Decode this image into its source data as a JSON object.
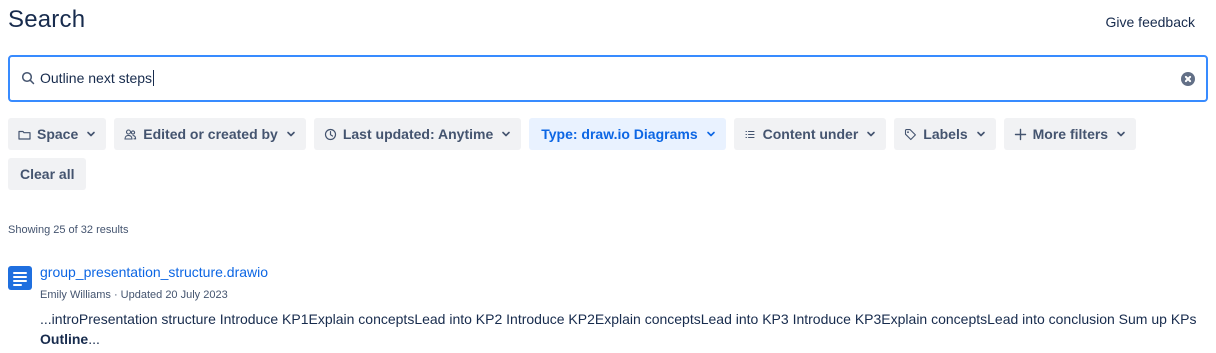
{
  "header": {
    "title": "Search",
    "feedback_label": "Give feedback"
  },
  "search": {
    "value": "Outline next steps",
    "icon": "search-icon",
    "clear_icon": "clear-icon"
  },
  "filters": [
    {
      "label": "Space",
      "icon": "folder-icon",
      "active": false
    },
    {
      "label": "Edited or created by",
      "icon": "people-icon",
      "active": false
    },
    {
      "label": "Last updated: Anytime",
      "icon": "clock-icon",
      "active": false
    },
    {
      "label": "Type: draw.io Diagrams",
      "icon": "",
      "active": true
    },
    {
      "label": "Content under",
      "icon": "list-icon",
      "active": false
    },
    {
      "label": "Labels",
      "icon": "tag-icon",
      "active": false
    },
    {
      "label": "More filters",
      "icon": "plus-icon",
      "active": false
    }
  ],
  "clear_all_label": "Clear all",
  "results_summary": "Showing 25 of 32 results",
  "results": [
    {
      "title": "group_presentation_structure.drawio",
      "author": "Emily Williams",
      "updated": "Updated 20 July 2023",
      "meta_separator": " · ",
      "snippet_before": "...introPresentation structure Introduce KP1Explain conceptsLead into KP2 Introduce KP2Explain conceptsLead into KP3 Introduce KP3Explain conceptsLead into conclusion Sum up KPs ",
      "snippet_highlight": "Outline",
      "snippet_after": "...",
      "icon": "page-icon"
    }
  ],
  "colors": {
    "accent": "#0c66e4",
    "focus_border": "#388bff",
    "chip_bg": "#f1f2f4",
    "chip_active_bg": "#e9f2ff",
    "text": "#172b4d",
    "subtle_text": "#44546f"
  }
}
